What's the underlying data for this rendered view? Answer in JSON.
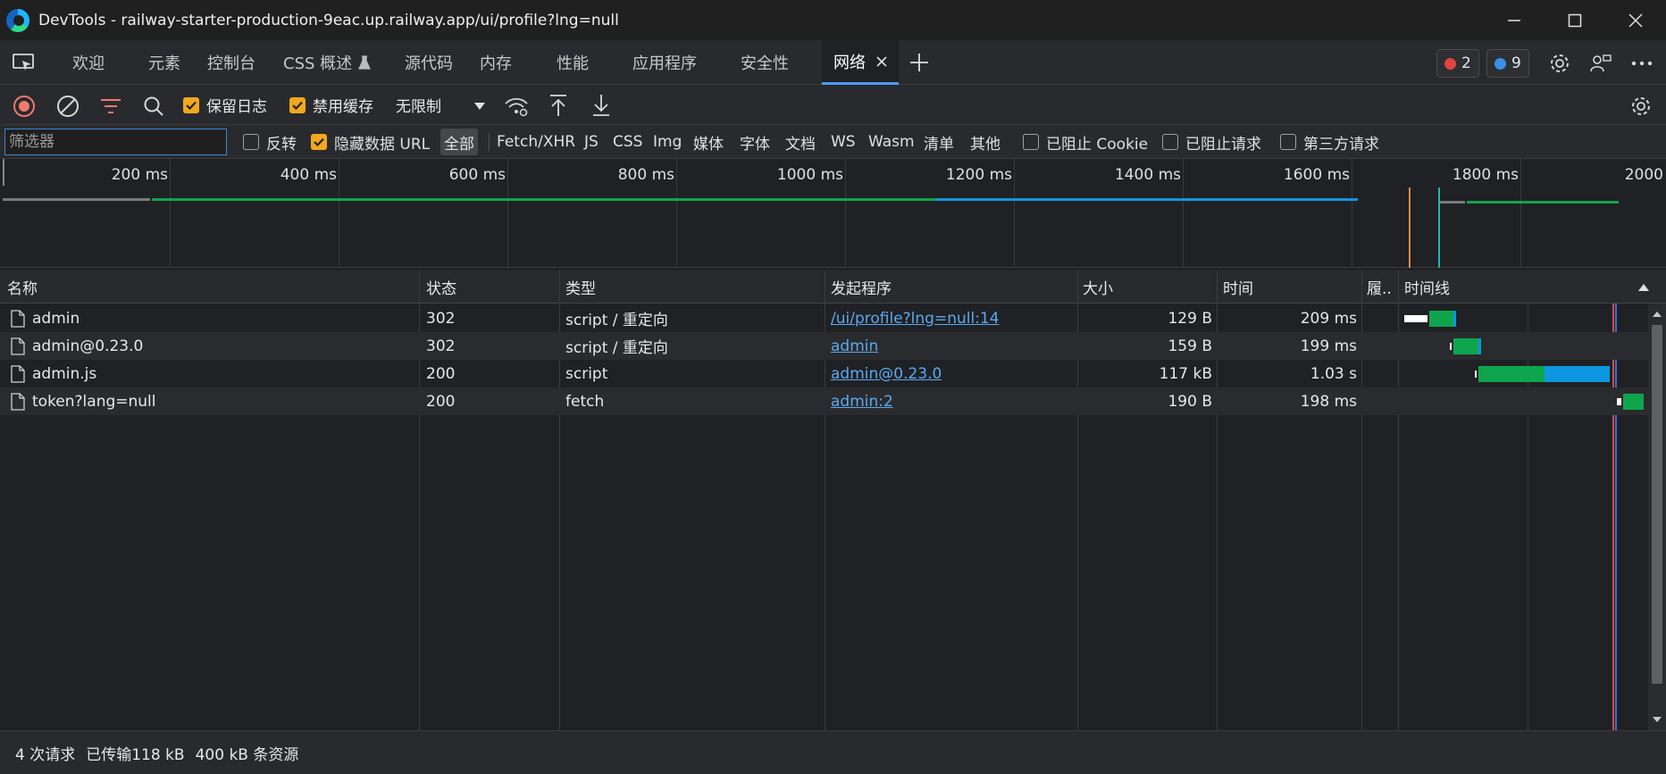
{
  "window": {
    "title": "DevTools - railway-starter-production-9eac.up.railway.app/ui/profile?lng=null"
  },
  "tabs": [
    {
      "label": "欢迎"
    },
    {
      "label": "元素"
    },
    {
      "label": "控制台"
    },
    {
      "label": "CSS 概述"
    },
    {
      "label": "源代码"
    },
    {
      "label": "内存"
    },
    {
      "label": "性能"
    },
    {
      "label": "应用程序"
    },
    {
      "label": "安全性"
    },
    {
      "label": "网络",
      "active": true
    }
  ],
  "badges": {
    "errors": "2",
    "messages": "9"
  },
  "toolbar": {
    "preserve_log": "保留日志",
    "disable_cache": "禁用缓存",
    "throttling": "无限制"
  },
  "filter": {
    "placeholder": "筛选器",
    "invert": "反转",
    "hide_data_urls": "隐藏数据 URL",
    "types": [
      "全部",
      "Fetch/XHR",
      "JS",
      "CSS",
      "Img",
      "媒体",
      "字体",
      "文档",
      "WS",
      "Wasm",
      "清单",
      "其他"
    ],
    "selected_type": "全部",
    "blocked_cookies": "已阻止 Cookie",
    "blocked_requests": "已阻止请求",
    "third_party": "第三方请求"
  },
  "overview": {
    "ticks": [
      "200 ms",
      "400 ms",
      "600 ms",
      "800 ms",
      "1000 ms",
      "1200 ms",
      "1400 ms",
      "1600 ms",
      "1800 ms",
      "2000"
    ]
  },
  "table": {
    "columns": [
      "名称",
      "状态",
      "类型",
      "发起程序",
      "大小",
      "时间",
      "履..",
      "时间线"
    ],
    "rows": [
      {
        "name": "admin",
        "status": "302",
        "type": "script / 重定向",
        "initiator": "/ui/profile?lng=null:14",
        "size": "129 B",
        "time": "209 ms"
      },
      {
        "name": "admin@0.23.0",
        "status": "302",
        "type": "script / 重定向",
        "initiator": "admin",
        "size": "159 B",
        "time": "199 ms"
      },
      {
        "name": "admin.js",
        "status": "200",
        "type": "script",
        "initiator": "admin@0.23.0",
        "size": "117 kB",
        "time": "1.03 s"
      },
      {
        "name": "token?lang=null",
        "status": "200",
        "type": "fetch",
        "initiator": "admin:2",
        "size": "190 B",
        "time": "198 ms"
      }
    ]
  },
  "status": {
    "requests": "4 次请求",
    "transferred": "已传输118 kB",
    "resources": "400 kB 条资源"
  },
  "colors": {
    "accent": "#4a9cf0",
    "checkbox": "#f1a81c",
    "waterfall_green": "#0fa54c",
    "waterfall_blue": "#0d97e0",
    "error_badge": "#e0443e",
    "message_badge": "#3a8ee6"
  }
}
